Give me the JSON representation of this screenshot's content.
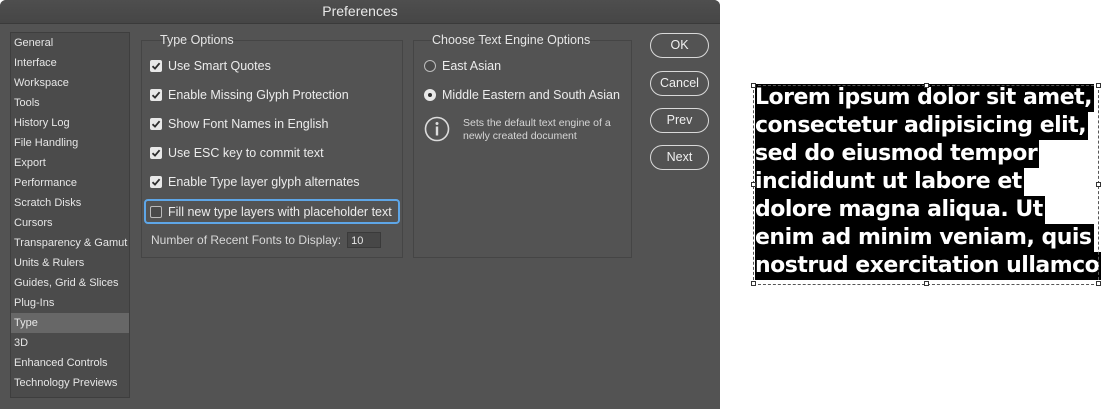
{
  "dialog": {
    "title": "Preferences"
  },
  "sidebar": {
    "selected": "Type",
    "items": [
      {
        "label": "General"
      },
      {
        "label": "Interface"
      },
      {
        "label": "Workspace"
      },
      {
        "label": "Tools"
      },
      {
        "label": "History Log"
      },
      {
        "label": "File Handling"
      },
      {
        "label": "Export"
      },
      {
        "label": "Performance"
      },
      {
        "label": "Scratch Disks"
      },
      {
        "label": "Cursors"
      },
      {
        "label": "Transparency & Gamut"
      },
      {
        "label": "Units & Rulers"
      },
      {
        "label": "Guides, Grid & Slices"
      },
      {
        "label": "Plug-Ins"
      },
      {
        "label": "Type"
      },
      {
        "label": "3D"
      },
      {
        "label": "Enhanced Controls"
      },
      {
        "label": "Technology Previews"
      }
    ]
  },
  "type_options": {
    "title": "Type Options",
    "checkboxes": [
      {
        "label": "Use Smart Quotes",
        "checked": true
      },
      {
        "label": "Enable Missing Glyph Protection",
        "checked": true
      },
      {
        "label": "Show Font Names in English",
        "checked": true
      },
      {
        "label": "Use ESC key to commit text",
        "checked": true
      },
      {
        "label": "Enable Type layer glyph alternates",
        "checked": true
      },
      {
        "label": "Fill new type layers with placeholder text",
        "checked": false
      }
    ],
    "recent_fonts_label": "Number of Recent Fonts to Display:",
    "recent_fonts_value": "10"
  },
  "text_engine": {
    "title": "Choose Text Engine Options",
    "options": [
      {
        "label": "East Asian",
        "selected": false
      },
      {
        "label": "Middle Eastern and South Asian",
        "selected": true
      }
    ],
    "info_text": "Sets the default text engine of a newly created document"
  },
  "buttons": {
    "ok": "OK",
    "cancel": "Cancel",
    "prev": "Prev",
    "next": "Next"
  },
  "canvas_text": {
    "lines": [
      "Lorem ipsum dolor sit amet,",
      "consectetur adipisicing elit,",
      "sed do eiusmod tempor",
      "incididunt ut labore et",
      "dolore magna aliqua. Ut",
      "enim ad minim veniam, quis",
      "nostrud exercitation ullamco"
    ]
  },
  "icons": {
    "check": "checkmark-icon",
    "info": "info-icon"
  },
  "colors": {
    "dialog_bg": "#535353",
    "focus_ring": "#5ea6e7",
    "selection_bg": "#000000"
  }
}
